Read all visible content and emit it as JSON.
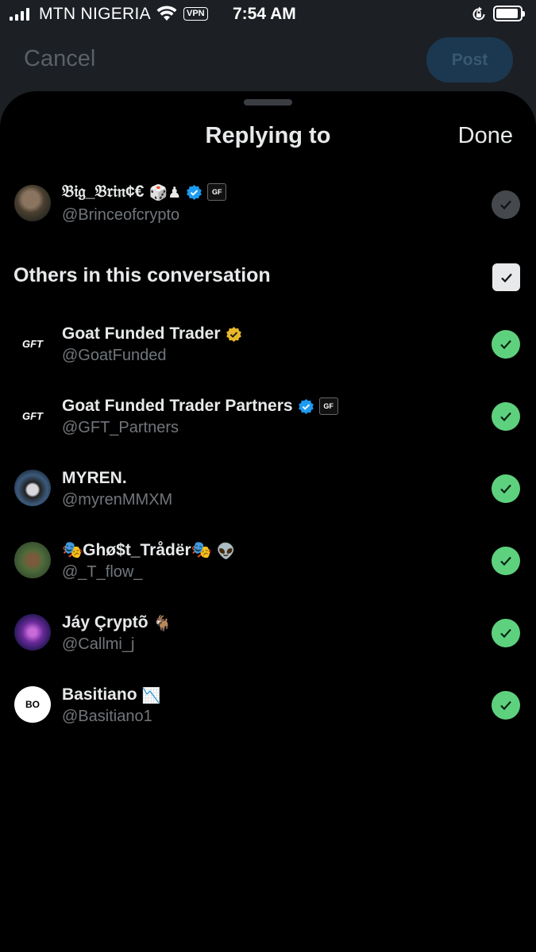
{
  "status_bar": {
    "carrier": "MTN NIGERIA",
    "vpn": "VPN",
    "time": "7:54 AM"
  },
  "compose": {
    "cancel_label": "Cancel",
    "post_label": "Post"
  },
  "sheet": {
    "title": "Replying to",
    "done_label": "Done",
    "section_title": "Others in this conversation"
  },
  "primary": {
    "name": "𝔅𝔦𝔤_𝔅𝔯𝔦𝔫¢€",
    "emojis": "🎲♟",
    "handle": "@Brinceofcrypto"
  },
  "users": [
    {
      "name": "Goat Funded Trader",
      "suffix": "",
      "handle": "@GoatFunded"
    },
    {
      "name": "Goat Funded Trader Partners",
      "suffix": "",
      "handle": "@GFT_Partners"
    },
    {
      "name": "MYREN.",
      "suffix": "",
      "handle": "@myrenMMXM"
    },
    {
      "name": "🎭Ghø$t_Trådër🎭",
      "suffix": "👽",
      "handle": "@_T_flow_"
    },
    {
      "name": "Jáy Çryptõ",
      "suffix": "🐐",
      "handle": "@Callmi_j"
    },
    {
      "name": "Basitiano",
      "suffix": "📉",
      "handle": "@Basitiano1"
    }
  ],
  "colors": {
    "accent_blue": "#1d9bf0",
    "gold": "#e8b82a",
    "check_green": "#5ed17e"
  }
}
